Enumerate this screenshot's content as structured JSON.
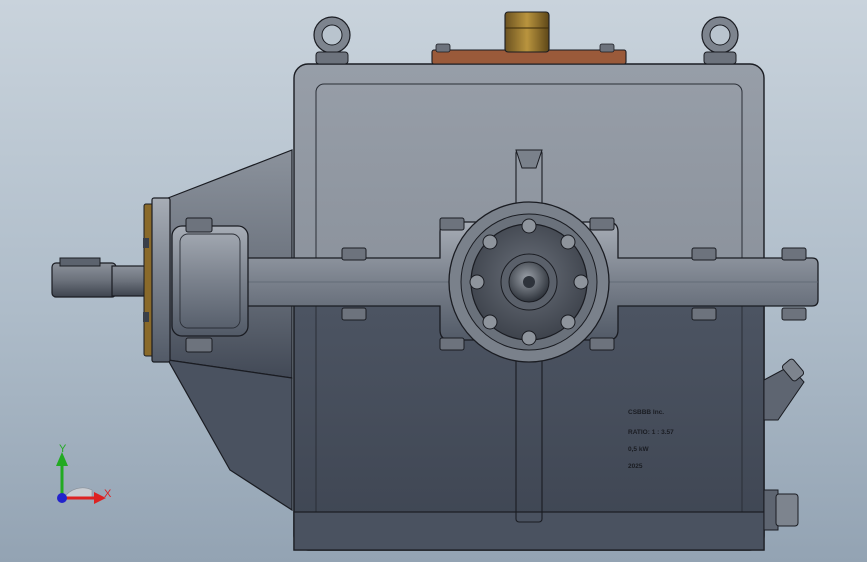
{
  "viewport": {
    "background_top": "#c9d3dc",
    "background_bottom": "#93a3b3"
  },
  "model": {
    "name_plate": {
      "line1": "CSBBB Inc.",
      "line2": "RATIO: 1 : 3.57",
      "line3": "0,5 kW",
      "line4": "2025"
    },
    "colors": {
      "housing_light": "#8a9099",
      "housing_dark": "#4a5260",
      "edge": "#1a1c22",
      "bronze_cap": "#8a6a2a",
      "copper_plate": "#9a5a3a"
    }
  },
  "triad": {
    "x_label": "X",
    "y_label": "Y",
    "x_color": "#d22",
    "y_color": "#2a2",
    "z_color": "#22c"
  }
}
